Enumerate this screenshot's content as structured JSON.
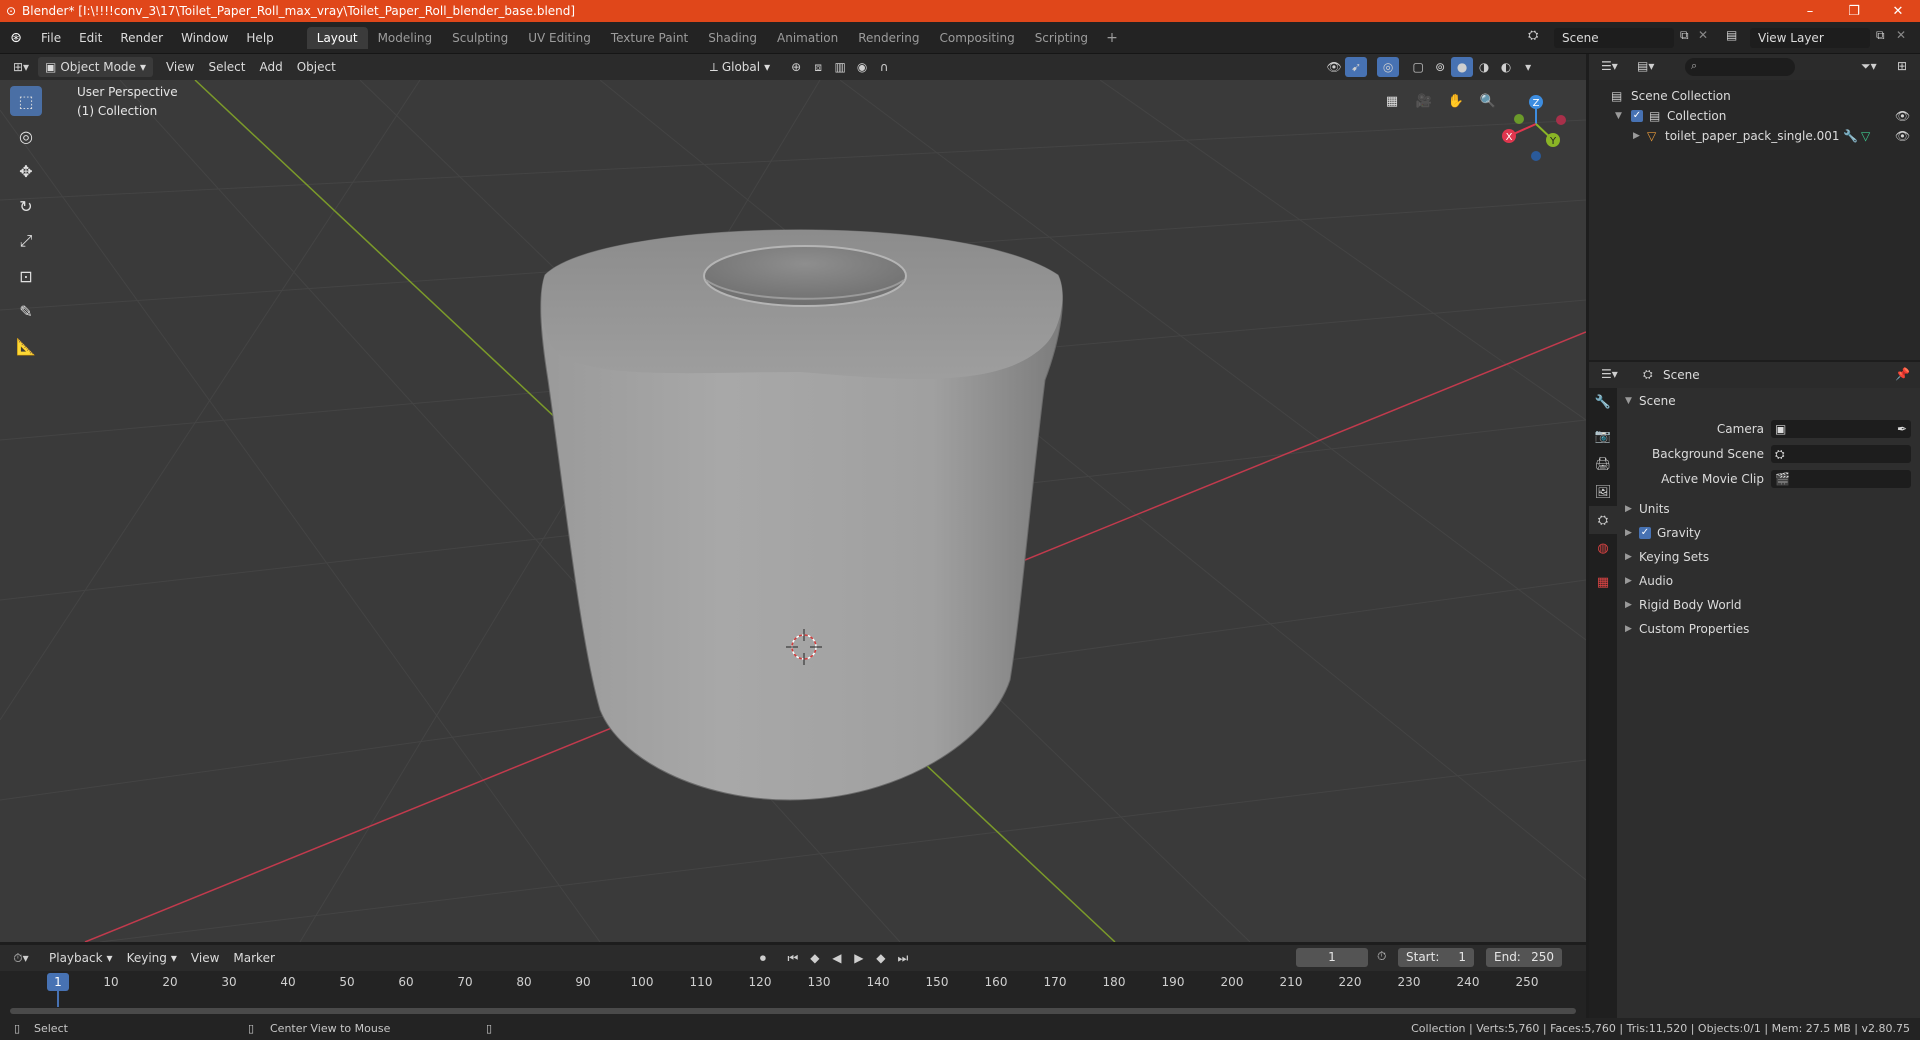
{
  "window": {
    "title": "Blender* [I:\\!!!!conv_3\\17\\Toilet_Paper_Roll_max_vray\\Toilet_Paper_Roll_blender_base.blend]",
    "min": "–",
    "max": "❐",
    "close": "✕"
  },
  "menu": [
    "File",
    "Edit",
    "Render",
    "Window",
    "Help"
  ],
  "workspaces": [
    "Layout",
    "Modeling",
    "Sculpting",
    "UV Editing",
    "Texture Paint",
    "Shading",
    "Animation",
    "Rendering",
    "Compositing",
    "Scripting"
  ],
  "workspace_add": "+",
  "scene": {
    "name": "Scene",
    "view_layer": "View Layer"
  },
  "viewport_header": {
    "mode": "Object Mode",
    "menus": [
      "View",
      "Select",
      "Add",
      "Object"
    ],
    "transform": "Global"
  },
  "viewport": {
    "perspective": "User Perspective",
    "collection": "(1) Collection",
    "gizmo": {
      "x": "X",
      "y": "Y",
      "z": "Z"
    }
  },
  "outliner": {
    "search_placeholder": "",
    "scene_collection": "Scene Collection",
    "collection": "Collection",
    "object": "toilet_paper_pack_single.001"
  },
  "properties": {
    "context": "Scene",
    "section": "Scene",
    "camera_label": "Camera",
    "background_label": "Background Scene",
    "movieclip_label": "Active Movie Clip",
    "panels": [
      "Units",
      "Gravity",
      "Keying Sets",
      "Audio",
      "Rigid Body World",
      "Custom Properties"
    ]
  },
  "timeline": {
    "menus": [
      "Playback",
      "Keying",
      "View",
      "Marker"
    ],
    "current_frame": "1",
    "start_label": "Start:",
    "start": "1",
    "end_label": "End:",
    "end": "250",
    "ruler": [
      "10",
      "20",
      "30",
      "40",
      "50",
      "60",
      "70",
      "80",
      "90",
      "100",
      "110",
      "120",
      "130",
      "140",
      "150",
      "160",
      "170",
      "180",
      "190",
      "200",
      "210",
      "220",
      "230",
      "240",
      "250"
    ],
    "ruler_current": "1"
  },
  "statusbar": {
    "select": "Select",
    "center": "Center View to Mouse",
    "stats": "Collection | Verts:5,760 | Faces:5,760 | Tris:11,520 | Objects:0/1 | Mem: 27.5 MB | v2.80.75"
  },
  "colors": {
    "accent": "#4772b3",
    "titlebar": "#e0471a",
    "x_axis": "#e0364e",
    "y_axis": "#8ab526",
    "z_axis": "#3d8de0"
  }
}
